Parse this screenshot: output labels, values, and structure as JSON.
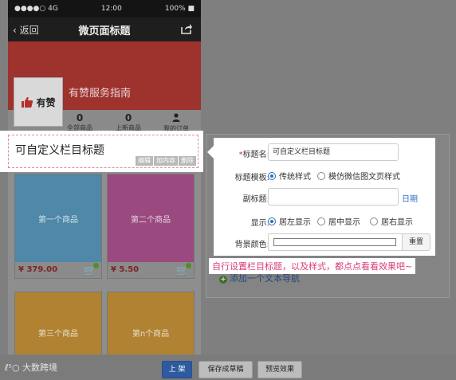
{
  "status_bar": {
    "carrier": "●●●●○ 4G",
    "time": "12:00",
    "battery": "100% ■"
  },
  "nav_bar": {
    "back_label": "返回",
    "title": "微页面标题",
    "share_icon": "share-icon"
  },
  "shop": {
    "name": "有赞服务指南",
    "logo_text": "有赞",
    "logo_icon": "thumbs-up-icon"
  },
  "stats": [
    {
      "count": "0",
      "label": "全部商品"
    },
    {
      "count": "0",
      "label": "上新商品"
    },
    {
      "count": "",
      "label": "我的订单",
      "icon": "user-icon"
    }
  ],
  "selected_module": {
    "title": "可自定义栏目标题",
    "actions": [
      "编辑",
      "加内容",
      "删除"
    ]
  },
  "goods": [
    {
      "name": "第一个商品",
      "price": "¥ 379.00",
      "color": "#4f88a8"
    },
    {
      "name": "第二个商品",
      "price": "¥ 5.50",
      "color": "#9b4a80"
    },
    {
      "name": "第三个商品",
      "price": "",
      "color": "#b08232"
    },
    {
      "name": "第n个商品",
      "price": "",
      "color": "#b08232"
    }
  ],
  "form": {
    "title_label": "标题名:",
    "title_value": "可自定义栏目标题",
    "template_label": "标题模板:",
    "template_options": [
      "传统样式",
      "模仿微信图文页样式"
    ],
    "subtitle_label": "副标题:",
    "subtitle_value": "",
    "date_link": "日期",
    "display_label": "显示:",
    "display_options": [
      "居左显示",
      "居中显示",
      "居右显示"
    ],
    "bgcolor_label": "背景颜色:",
    "bgcolor_value": "#ffffff",
    "reset_label": "重置"
  },
  "tip_text": "自行设置栏目标题，以及样式，都点点看看效果吧~",
  "add_text_nav": "添加一个文本导航",
  "bottom_bar": {
    "watermark": "大数跨境",
    "publish": "上 架",
    "save_draft": "保存成草稿",
    "preview": "预览效果"
  },
  "colors": {
    "primary": "#2e5aa0",
    "tip": "#d93a7a",
    "banner": "#9e322d",
    "required": "#c9302c"
  }
}
